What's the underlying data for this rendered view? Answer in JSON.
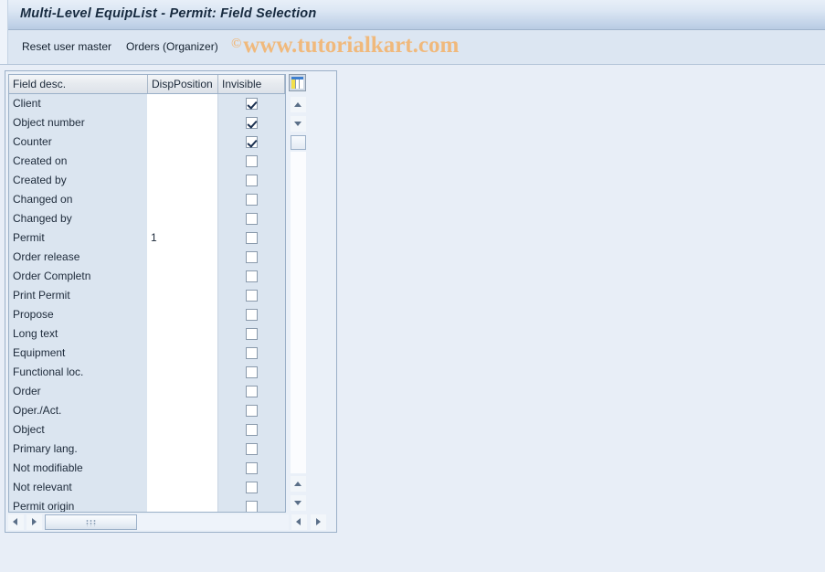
{
  "window": {
    "title": "Multi-Level EquipList - Permit: Field Selection"
  },
  "toolbar": {
    "reset_label": "Reset user master",
    "orders_label": "Orders (Organizer)",
    "watermark_symbol": "©",
    "watermark_text": "www.tutorialkart.com"
  },
  "grid": {
    "columns": [
      "Field desc.",
      "DispPosition",
      "Invisible"
    ],
    "config_icon": "column-config-icon",
    "rows": [
      {
        "field": "Client",
        "disp": "",
        "invisible": true
      },
      {
        "field": "Object number",
        "disp": "",
        "invisible": true
      },
      {
        "field": "Counter",
        "disp": "",
        "invisible": true
      },
      {
        "field": "Created on",
        "disp": "",
        "invisible": false
      },
      {
        "field": "Created by",
        "disp": "",
        "invisible": false
      },
      {
        "field": "Changed on",
        "disp": "",
        "invisible": false
      },
      {
        "field": "Changed by",
        "disp": "",
        "invisible": false
      },
      {
        "field": "Permit",
        "disp": "1",
        "invisible": false
      },
      {
        "field": "Order release",
        "disp": "",
        "invisible": false
      },
      {
        "field": "Order Completn",
        "disp": "",
        "invisible": false
      },
      {
        "field": "Print Permit",
        "disp": "",
        "invisible": false
      },
      {
        "field": "Propose",
        "disp": "",
        "invisible": false
      },
      {
        "field": "Long text",
        "disp": "",
        "invisible": false
      },
      {
        "field": "Equipment",
        "disp": "",
        "invisible": false
      },
      {
        "field": "Functional loc.",
        "disp": "",
        "invisible": false
      },
      {
        "field": "Order",
        "disp": "",
        "invisible": false
      },
      {
        "field": "Oper./Act.",
        "disp": "",
        "invisible": false
      },
      {
        "field": "Object",
        "disp": "",
        "invisible": false
      },
      {
        "field": "Primary lang.",
        "disp": "",
        "invisible": false
      },
      {
        "field": "Not modifiable",
        "disp": "",
        "invisible": false
      },
      {
        "field": "Not relevant",
        "disp": "",
        "invisible": false
      },
      {
        "field": "Permit origin",
        "disp": "",
        "invisible": false
      }
    ]
  },
  "scrollbars": {
    "vertical_up": "scroll-up-icon",
    "vertical_down": "scroll-down-icon",
    "horizontal_left": "scroll-left-icon",
    "horizontal_right": "scroll-right-icon"
  },
  "colors": {
    "title_text": "#172a3f",
    "watermark": "#f0b97c",
    "row_background": "#dbe5f0",
    "page_background": "#e8eef7"
  }
}
